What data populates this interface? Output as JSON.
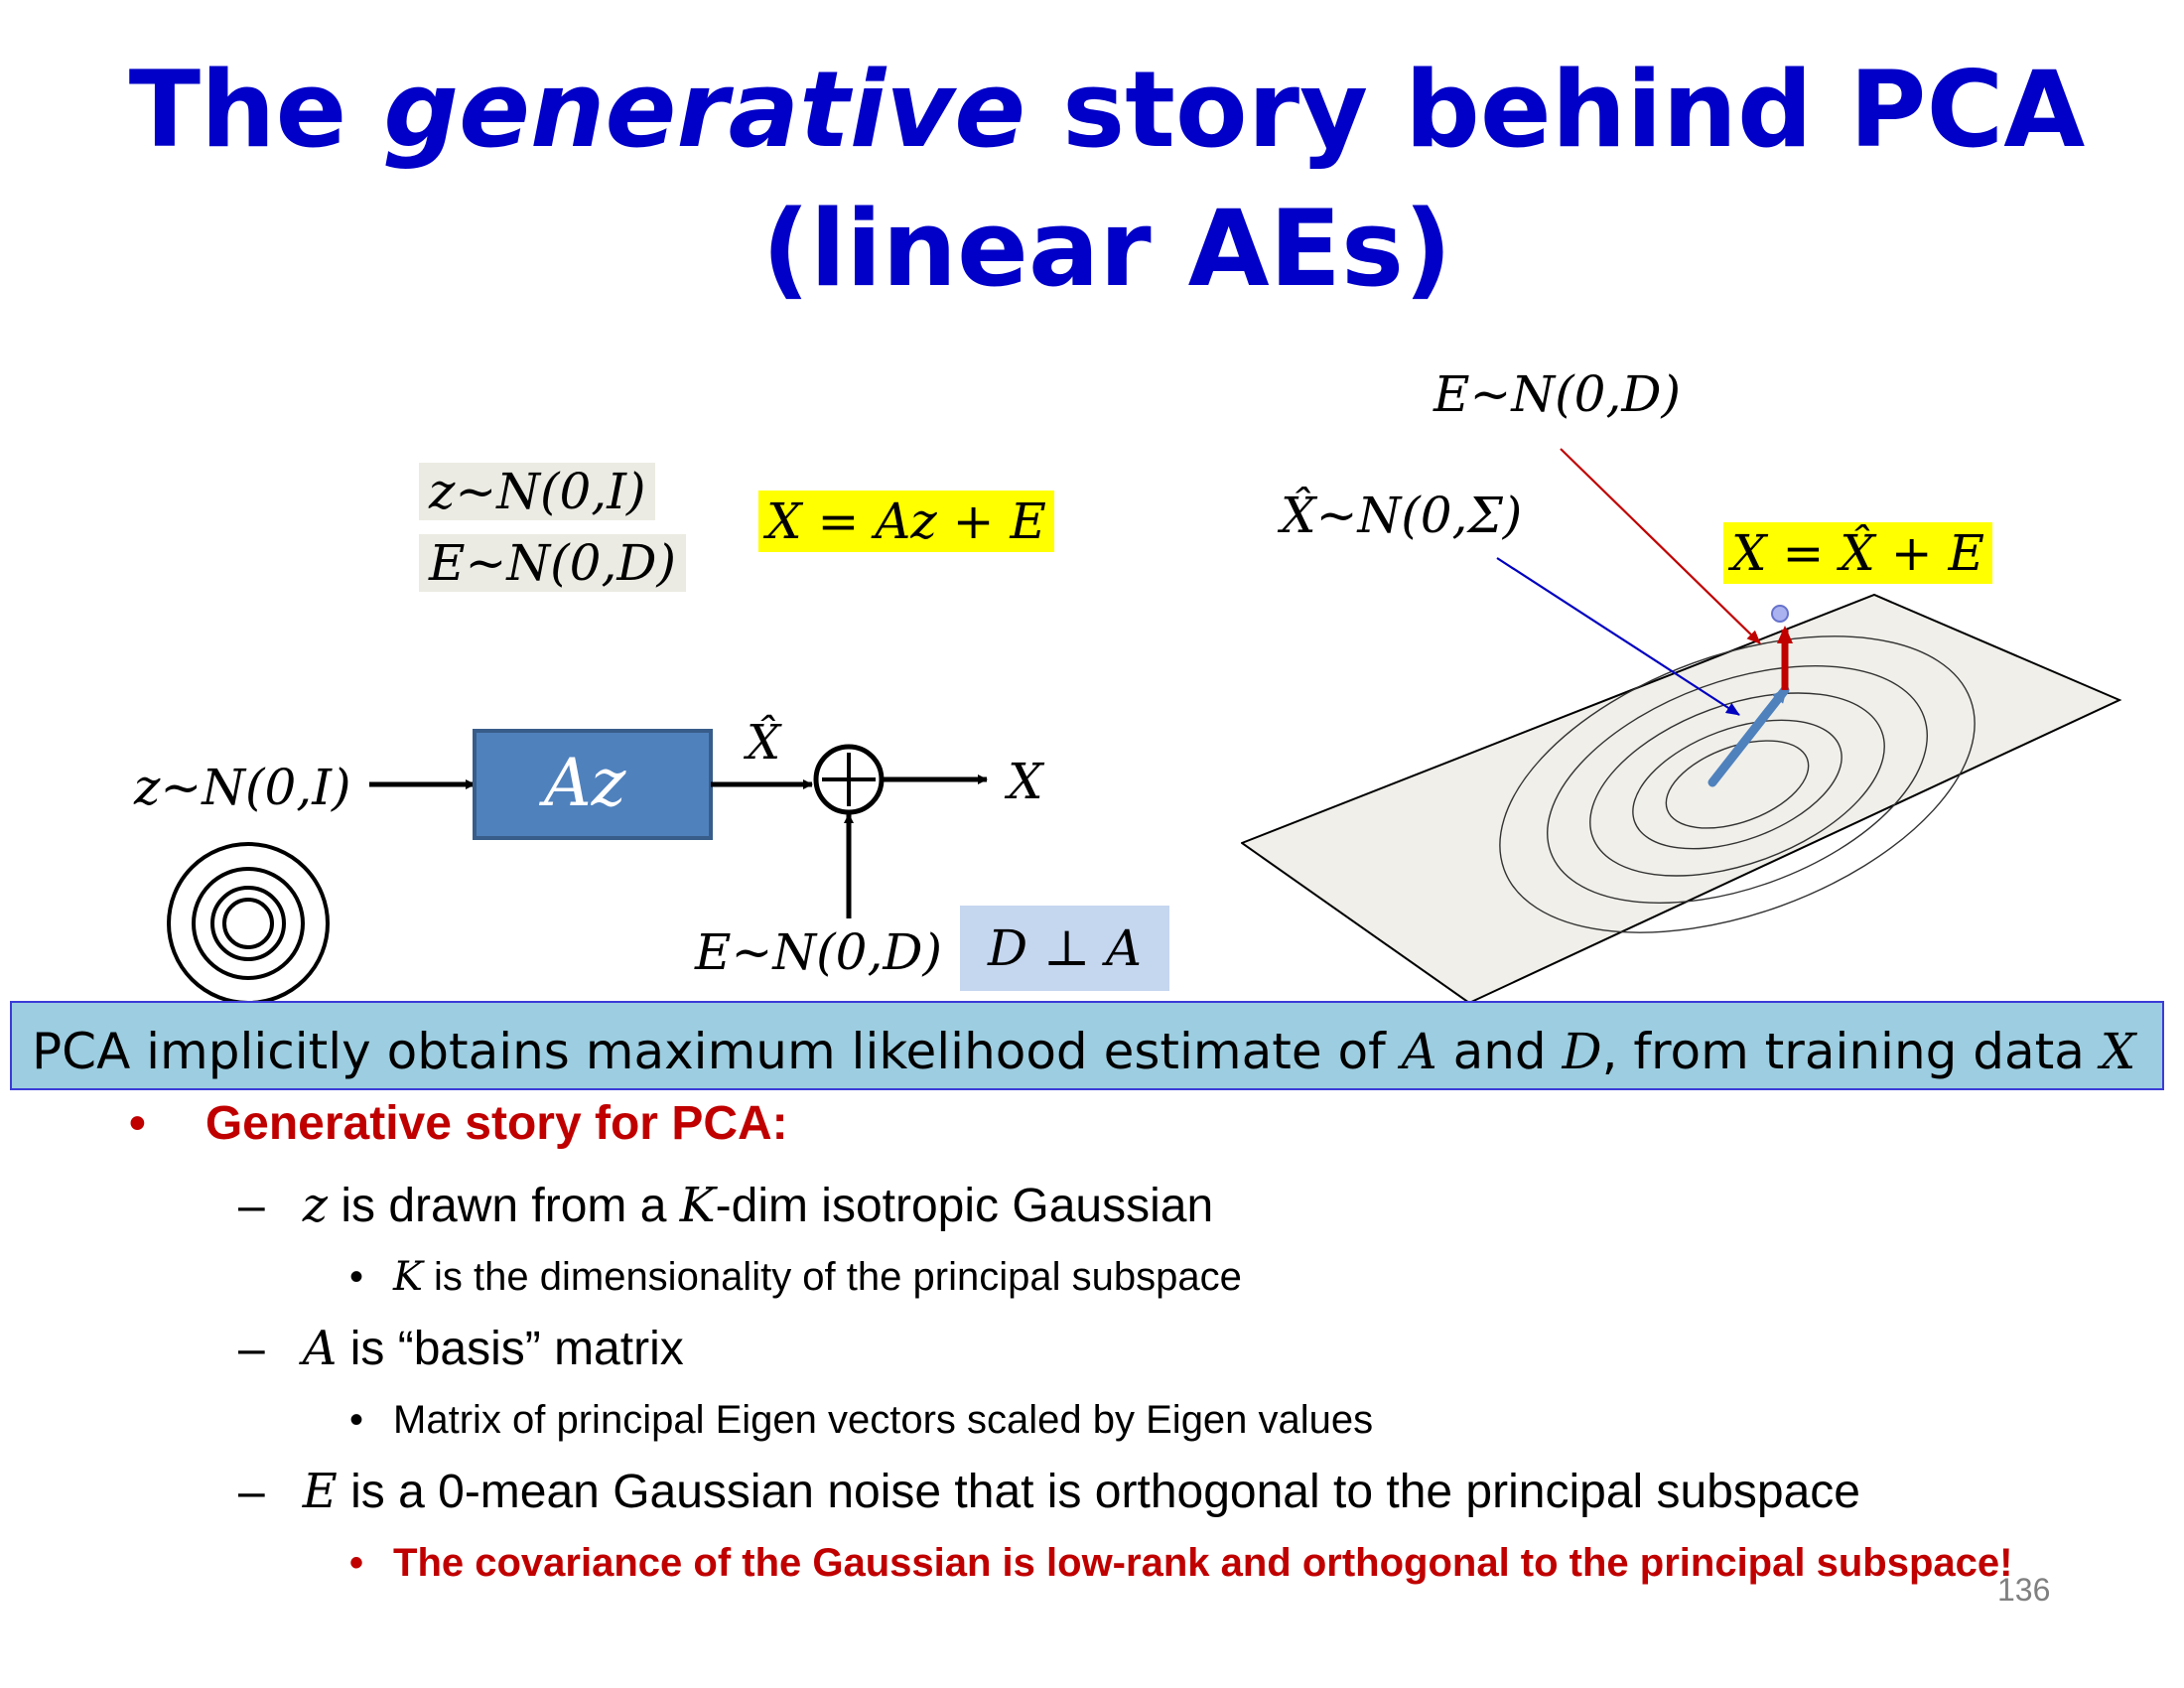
{
  "title": {
    "part1": "The ",
    "italic": "generative",
    "part2": " story behind PCA",
    "line2": "(linear AEs)"
  },
  "equations": {
    "z_prior_box": "z~N(0,I)",
    "e_prior_box": "E~N(0,D)",
    "model": "X = Az + E",
    "z_input": "z~N(0,I)",
    "encoder_block": "Az",
    "xhat_label": "X̂",
    "output": "X",
    "noise_input": "E~N(0,D)",
    "orthogonality": "D ⊥ A",
    "noise_top": "E~N(0,D)",
    "xhat_dist": "X̂~N(0,Σ)",
    "decomposition": "X = X̂ + E"
  },
  "banner": {
    "text1": "PCA implicitly obtains maximum likelihood estimate of ",
    "var_a": "A",
    "text2": " and ",
    "var_d": "D",
    "text3": ", from training data ",
    "var_x": "X"
  },
  "bullets": {
    "heading": "Generative story for PCA:",
    "items": [
      {
        "var": "z",
        "text": " is drawn from a ",
        "var2": "K",
        "text2": "-dim isotropic Gaussian",
        "sub_var": "K",
        "sub_text": " is the dimensionality of the principal subspace"
      },
      {
        "var": "A",
        "text": " is “basis” matrix",
        "sub_text": "Matrix of principal Eigen vectors scaled by Eigen values"
      },
      {
        "var": "E",
        "text": " is a 0-mean Gaussian noise that is orthogonal to the principal subspace",
        "sub_text": "The covariance of the Gaussian is low-rank and orthogonal to the principal subspace!"
      }
    ]
  },
  "glyphs": {
    "bullet": "•",
    "dash": "–",
    "plus": "+"
  },
  "page_number": "136",
  "colors": {
    "title": "#0000c8",
    "emphasis": "#c00000",
    "block_fill": "#4f81bd",
    "banner": "#9ccde0",
    "highlight": "#ffff00"
  }
}
